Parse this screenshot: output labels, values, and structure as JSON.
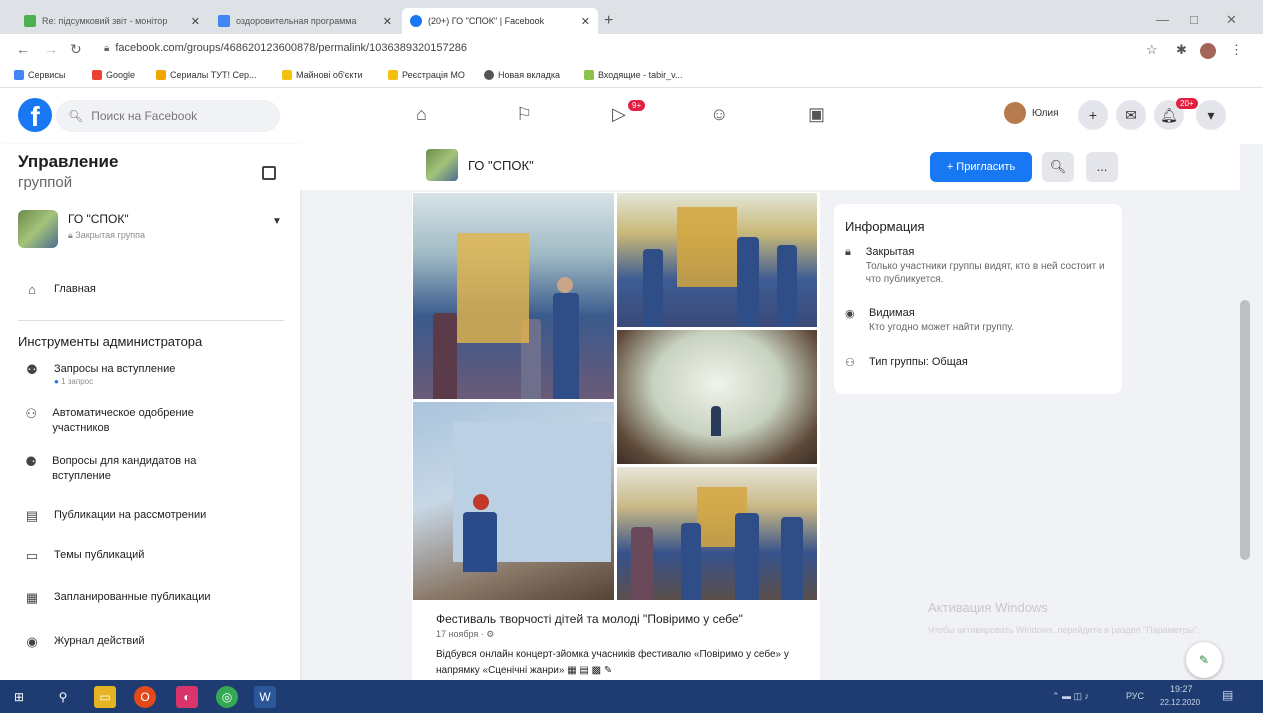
{
  "browser": {
    "tabs": [
      {
        "title": "Re: підсумковий звіт - монітор",
        "color": "#4caf50"
      },
      {
        "title": "оздоровительная программа",
        "color": "#4285f4"
      },
      {
        "title": "(20+) ГО \"СПОК\" | Facebook",
        "color": "#1877f2"
      }
    ],
    "url": "facebook.com/groups/468620123600878/permalink/1036389320157286",
    "bookmarks": [
      {
        "label": "Сервисы",
        "color": "#4285f4"
      },
      {
        "label": "Google",
        "color": "#ea4335"
      },
      {
        "label": "Сериалы ТУТ! Сер...",
        "color": "#f0a500"
      },
      {
        "label": "Майнові об'єкти",
        "color": "#f4c20d"
      },
      {
        "label": "Реєстрація МО",
        "color": "#f4c20d"
      },
      {
        "label": "Новая вкладка",
        "color": "#555555"
      },
      {
        "label": "Входящие - tabir_v...",
        "color": "#8bc34a"
      }
    ]
  },
  "fb": {
    "logo": "f",
    "search_placeholder": "Поиск на Facebook",
    "badges": {
      "watch": "9+",
      "notifications": "20+"
    },
    "user_name": "Юлия",
    "accent": "#1877f2"
  },
  "sidebar": {
    "title": "Управление",
    "subtitle": "группой",
    "group": {
      "name": "ГО \"СПОК\"",
      "type": "Закрытая группа"
    },
    "home": "Главная",
    "tools_heading": "Инструменты администратора",
    "items": [
      {
        "label": "Запросы на вступление",
        "sub": "1 запрос"
      },
      {
        "label": "Автоматическое одобрение участников"
      },
      {
        "label": "Вопросы для кандидатов на вступление"
      },
      {
        "label": "Публикации на рассмотрении"
      },
      {
        "label": "Темы публикаций"
      },
      {
        "label": "Запланированные публикации"
      },
      {
        "label": "Журнал действий"
      }
    ]
  },
  "group_header": {
    "name": "ГО \"СПОК\"",
    "invite_label": "+ Пригласить",
    "more": "..."
  },
  "post": {
    "title": "Фестиваль творчості дітей та молоді \"Повіримо у себе\"",
    "date": "17 ноября · ⚙",
    "body": "Відбувся онлайн концерт-зйомка учасників фестивалю «Повіримо у себе» у напрямку «Сценічні жанри» ▦ ▤ ▩ ✎"
  },
  "info": {
    "title": "Информация",
    "rows": [
      {
        "title": "Закрытая",
        "desc": "Только участники группы видят, кто в ней состоит и что публикуется."
      },
      {
        "title": "Видимая",
        "desc": "Кто угодно может найти группу."
      },
      {
        "title": "Тип группы: Общая",
        "desc": ""
      }
    ]
  },
  "windows_activation": {
    "title": "Активация Windows",
    "desc": "Чтобы активировать Windows, перейдите в раздел \"Параметры\"."
  },
  "taskbar": {
    "lang": "РУС",
    "time": "19:27",
    "date": "22.12.2020"
  }
}
